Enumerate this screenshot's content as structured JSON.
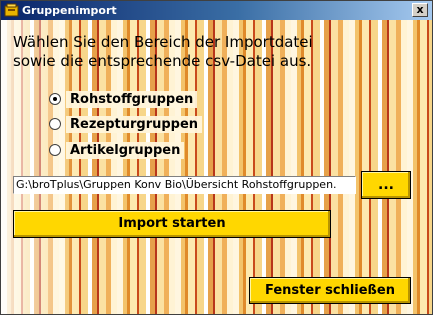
{
  "window": {
    "title": "Gruppenimport",
    "close_label": "x"
  },
  "intro": {
    "line1": "Wählen Sie den Bereich der Importdatei",
    "line2": "sowie die entsprechende csv-Datei aus."
  },
  "options": [
    {
      "label": "Rohstoffgruppen",
      "selected": true
    },
    {
      "label": "Rezepturgruppen",
      "selected": false
    },
    {
      "label": "Artikelgruppen",
      "selected": false
    }
  ],
  "file": {
    "path": "G:\\broTplus\\Gruppen Konv Bio\\Übersicht Rohstoffgruppen."
  },
  "buttons": {
    "browse": "...",
    "import": "Import starten",
    "close_window": "Fenster schließen"
  },
  "colors": {
    "button": "#ffd700",
    "titlebar_start": "#0a246a",
    "titlebar_end": "#a6caf0"
  }
}
